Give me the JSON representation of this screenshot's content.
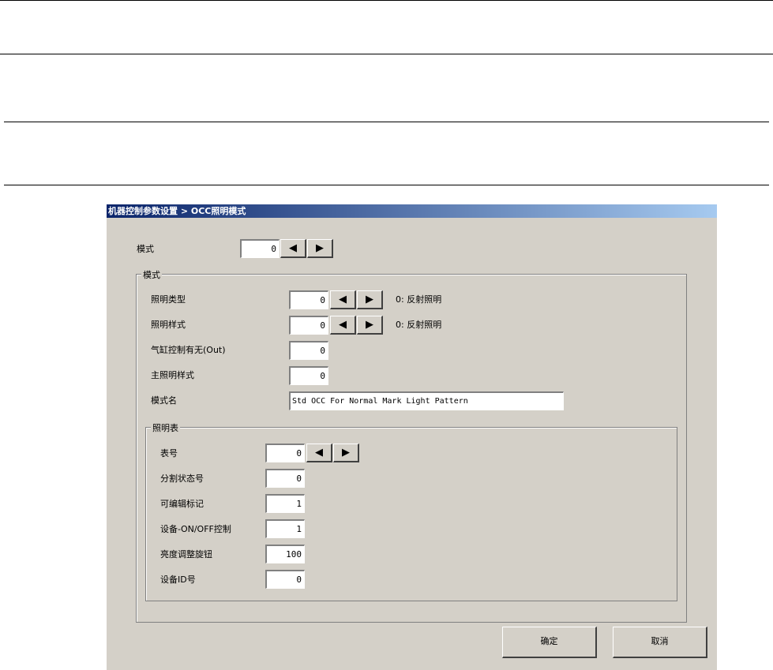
{
  "dialog": {
    "title": "机器控制参数设置 > OCC照明模式"
  },
  "mode": {
    "label": "模式",
    "value": "0"
  },
  "mode_group": {
    "title": "模式",
    "lighting_type": {
      "label": "照明类型",
      "value": "0",
      "desc": "0: 反射照明"
    },
    "lighting_style": {
      "label": "照明样式",
      "value": "0",
      "desc": "0: 反射照明"
    },
    "cylinder": {
      "label": "气缸控制有无(Out)",
      "value": "0"
    },
    "main_style": {
      "label": "主照明样式",
      "value": "0"
    },
    "mode_name": {
      "label": "模式名",
      "value": "Std OCC For Normal Mark Light Pattern"
    }
  },
  "table_group": {
    "title": "照明表",
    "table_no": {
      "label": "表号",
      "value": "0"
    },
    "split_state": {
      "label": "分割状态号",
      "value": "0"
    },
    "editable": {
      "label": "可编辑标记",
      "value": "1"
    },
    "onoff": {
      "label": "设备-ON/OFF控制",
      "value": "1"
    },
    "brightness": {
      "label": "亮度调整旋钮",
      "value": "100"
    },
    "device_id": {
      "label": "设备ID号",
      "value": "0"
    }
  },
  "buttons": {
    "ok": "确定",
    "cancel": "取消",
    "prev": "◀",
    "next": "▶"
  }
}
